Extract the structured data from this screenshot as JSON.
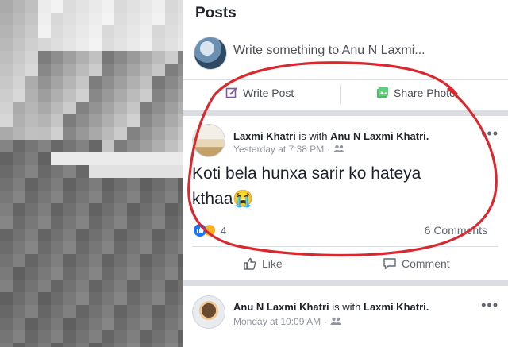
{
  "posts_section": {
    "title": "Posts"
  },
  "composer": {
    "placeholder": "Write something to Anu N Laxmi..."
  },
  "composer_actions": {
    "write_post": "Write Post",
    "share_photo": "Share Photo"
  },
  "post1": {
    "author": "Laxmi Khatri",
    "with_text": "is with",
    "tagged": "Anu N Laxmi Khatri.",
    "time": "Yesterday at 7:38 PM",
    "more": "•••",
    "body_line1": "Koti bela hunxa  sarir ko hateya",
    "body_line2": "kthaa😭",
    "reaction_count": "4",
    "comments_count": "6 Comments",
    "like_label": "Like",
    "comment_label": "Comment"
  },
  "post2": {
    "author": "Anu N Laxmi Khatri",
    "with_text": "is with",
    "tagged": "Laxmi Khatri.",
    "time": "Monday at 10:09 AM",
    "more": "•••"
  },
  "colors": {
    "annotation_red": "#d9282f",
    "facebook_blue": "#1877f2",
    "photo_green": "#45bd62"
  }
}
